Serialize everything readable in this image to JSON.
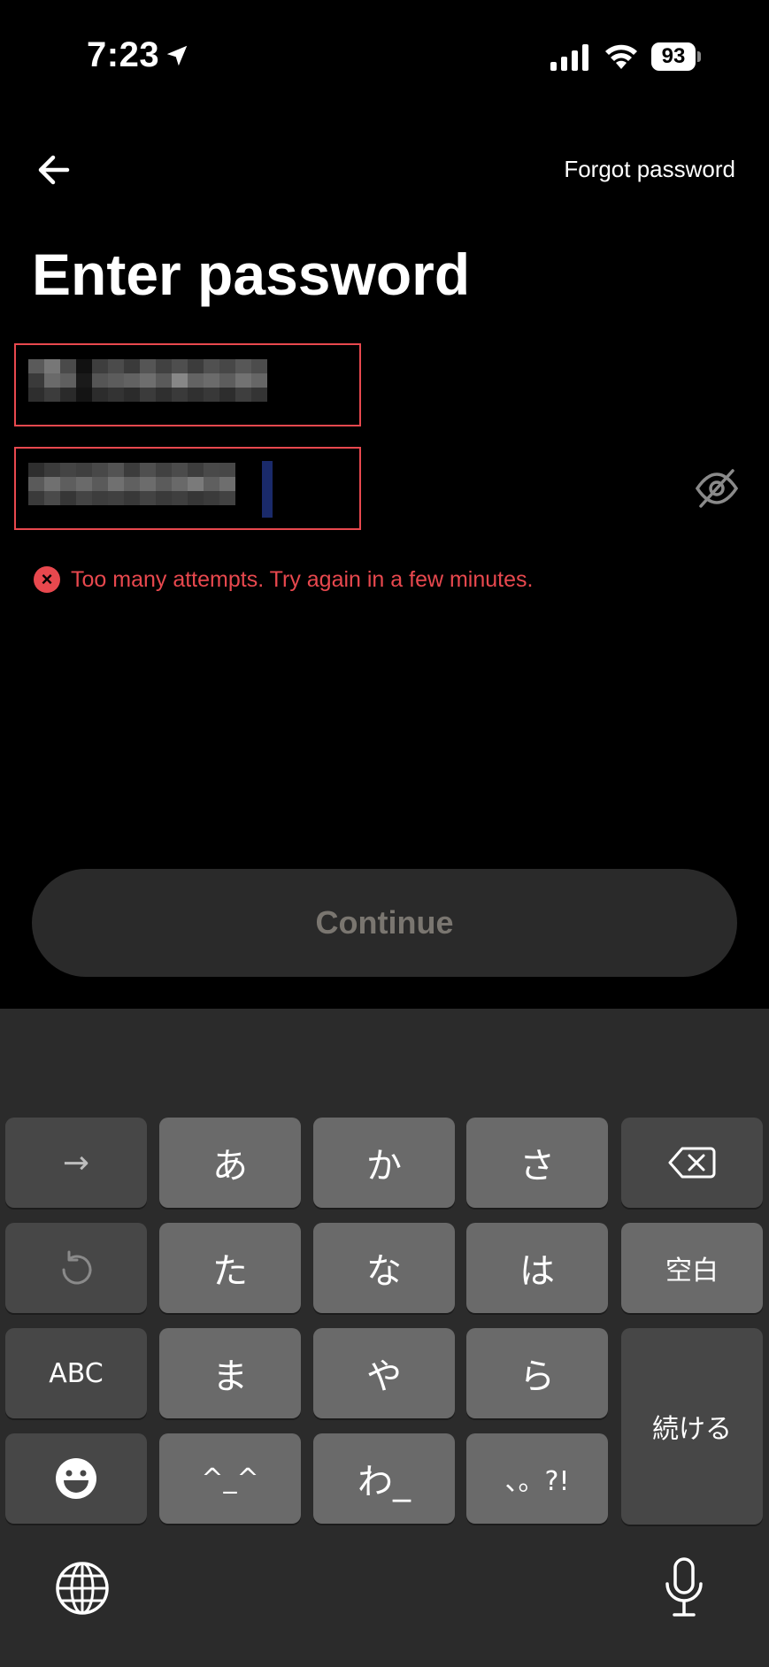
{
  "status_bar": {
    "time": "7:23",
    "battery": "93"
  },
  "header": {
    "forgot_password": "Forgot password"
  },
  "page": {
    "title": "Enter password"
  },
  "form": {
    "username_value": "",
    "password_value": "",
    "error_message": "Too many attempts. Try again in a few minutes.",
    "error_glyph": "×"
  },
  "actions": {
    "continue_label": "Continue"
  },
  "keyboard": {
    "rows": [
      [
        "→",
        "あ",
        "か",
        "さ",
        "delete"
      ],
      [
        "undo",
        "た",
        "な",
        "は",
        "空白"
      ],
      [
        "ABC",
        "ま",
        "や",
        "ら",
        "続ける"
      ],
      [
        "emoji",
        "^_^",
        "わ_",
        "、。?!"
      ]
    ],
    "arrow": "→",
    "k_a": "あ",
    "k_ka": "か",
    "k_sa": "さ",
    "k_ta": "た",
    "k_na": "な",
    "k_ha": "は",
    "space": "空白",
    "abc": "ABC",
    "k_ma": "ま",
    "k_ya": "や",
    "k_ra": "ら",
    "enter": "続ける",
    "kaomoji": "^_^",
    "k_wa": "わ_",
    "punct": "、。?!"
  },
  "colors": {
    "background": "#000000",
    "error": "#e8484e",
    "keyboard_bg": "#2b2b2b",
    "key_light": "#6a6a6a",
    "key_dark": "#474747"
  },
  "icons": {
    "back": "arrow-left-icon",
    "location": "location-arrow-icon",
    "signal": "cellular-signal-icon",
    "wifi": "wifi-icon",
    "eye": "eye-slash-icon",
    "error": "error-x-circle-icon",
    "delete": "backspace-icon",
    "undo": "undo-icon",
    "emoji": "emoji-icon",
    "globe": "globe-icon",
    "mic": "microphone-icon"
  }
}
